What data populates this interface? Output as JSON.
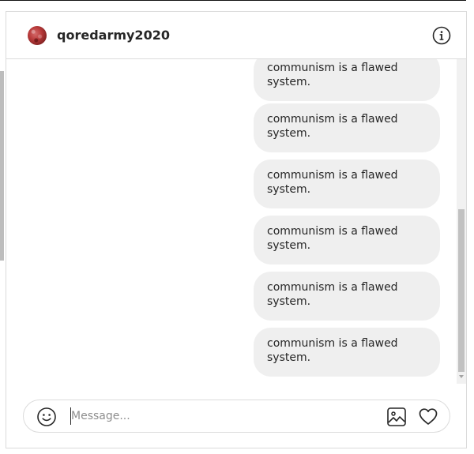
{
  "header": {
    "username": "qoredarmy2020",
    "avatar": "profile-avatar",
    "info_icon": "info-icon"
  },
  "messages": [
    {
      "text": "communism is a flawed system.",
      "sender": "self"
    },
    {
      "text": "communism is a flawed system.",
      "sender": "self"
    },
    {
      "text": "communism is a flawed system.",
      "sender": "self"
    },
    {
      "text": "communism is a flawed system.",
      "sender": "self"
    },
    {
      "text": "communism is a flawed system.",
      "sender": "self"
    },
    {
      "text": "communism is a flawed system.",
      "sender": "self"
    }
  ],
  "composer": {
    "placeholder": "Message...",
    "value": "",
    "emoji_icon": "emoji-icon",
    "image_icon": "image-icon",
    "heart_icon": "heart-icon"
  },
  "colors": {
    "bubble_bg": "#efefef",
    "text": "#262626",
    "border": "#dbdbdb",
    "placeholder": "#8e8e8e"
  }
}
